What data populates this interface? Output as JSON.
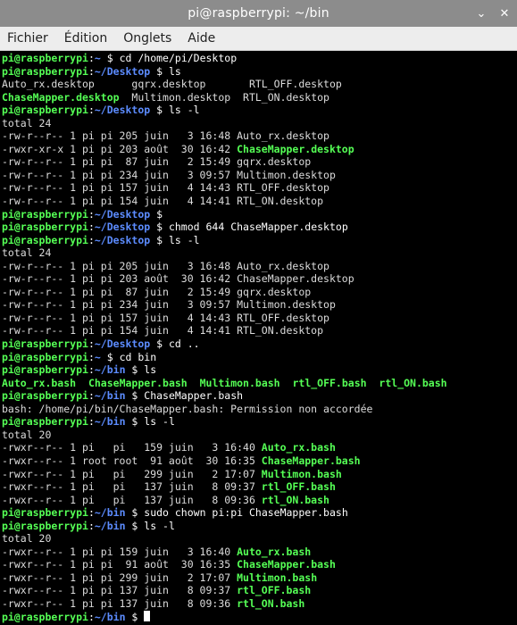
{
  "window": {
    "title": "pi@raspberrypi: ~/bin",
    "min_icon": "chevron-down-icon",
    "close_icon": "close-icon"
  },
  "menu": [
    "Fichier",
    "Édition",
    "Onglets",
    "Aide"
  ],
  "colors": {
    "prompt": "#55ff55",
    "path": "#5c8cff",
    "exec": "#55ff55",
    "titlebar": "#8c8c8c",
    "menubar": "#ededed"
  },
  "terminal": [
    [
      [
        "p",
        "pi@raspberrypi"
      ],
      [
        "c",
        ":"
      ],
      [
        "d",
        "~"
      ],
      [
        "c",
        " $ cd /home/pi/Desktop"
      ]
    ],
    [
      [
        "p",
        "pi@raspberrypi"
      ],
      [
        "c",
        ":"
      ],
      [
        "d",
        "~/Desktop"
      ],
      [
        "c",
        " $ ls"
      ]
    ],
    [
      [
        "o",
        "Auto_rx.desktop      gqrx.desktop       RTL_OFF.desktop"
      ]
    ],
    [
      [
        "g",
        "ChaseMapper.desktop"
      ],
      [
        "o",
        "  Multimon.desktop  RTL_ON.desktop"
      ]
    ],
    [
      [
        "p",
        "pi@raspberrypi"
      ],
      [
        "c",
        ":"
      ],
      [
        "d",
        "~/Desktop"
      ],
      [
        "c",
        " $ ls -l"
      ]
    ],
    [
      [
        "o",
        "total 24"
      ]
    ],
    [
      [
        "o",
        "-rw-r--r-- 1 pi pi 205 juin   3 16:48 Auto_rx.desktop"
      ]
    ],
    [
      [
        "o",
        "-rwxr-xr-x 1 pi pi 203 août  30 16:42 "
      ],
      [
        "g",
        "ChaseMapper.desktop"
      ]
    ],
    [
      [
        "o",
        "-rw-r--r-- 1 pi pi  87 juin   2 15:49 gqrx.desktop"
      ]
    ],
    [
      [
        "o",
        "-rw-r--r-- 1 pi pi 234 juin   3 09:57 Multimon.desktop"
      ]
    ],
    [
      [
        "o",
        "-rw-r--r-- 1 pi pi 157 juin   4 14:43 RTL_OFF.desktop"
      ]
    ],
    [
      [
        "o",
        "-rw-r--r-- 1 pi pi 154 juin   4 14:41 RTL_ON.desktop"
      ]
    ],
    [
      [
        "p",
        "pi@raspberrypi"
      ],
      [
        "c",
        ":"
      ],
      [
        "d",
        "~/Desktop"
      ],
      [
        "c",
        " $"
      ]
    ],
    [
      [
        "p",
        "pi@raspberrypi"
      ],
      [
        "c",
        ":"
      ],
      [
        "d",
        "~/Desktop"
      ],
      [
        "c",
        " $ chmod 644 ChaseMapper.desktop"
      ]
    ],
    [
      [
        "p",
        "pi@raspberrypi"
      ],
      [
        "c",
        ":"
      ],
      [
        "d",
        "~/Desktop"
      ],
      [
        "c",
        " $ ls -l"
      ]
    ],
    [
      [
        "o",
        "total 24"
      ]
    ],
    [
      [
        "o",
        "-rw-r--r-- 1 pi pi 205 juin   3 16:48 Auto_rx.desktop"
      ]
    ],
    [
      [
        "o",
        "-rw-r--r-- 1 pi pi 203 août  30 16:42 ChaseMapper.desktop"
      ]
    ],
    [
      [
        "o",
        "-rw-r--r-- 1 pi pi  87 juin   2 15:49 gqrx.desktop"
      ]
    ],
    [
      [
        "o",
        "-rw-r--r-- 1 pi pi 234 juin   3 09:57 Multimon.desktop"
      ]
    ],
    [
      [
        "o",
        "-rw-r--r-- 1 pi pi 157 juin   4 14:43 RTL_OFF.desktop"
      ]
    ],
    [
      [
        "o",
        "-rw-r--r-- 1 pi pi 154 juin   4 14:41 RTL_ON.desktop"
      ]
    ],
    [
      [
        "p",
        "pi@raspberrypi"
      ],
      [
        "c",
        ":"
      ],
      [
        "d",
        "~/Desktop"
      ],
      [
        "c",
        " $ cd .."
      ]
    ],
    [
      [
        "p",
        "pi@raspberrypi"
      ],
      [
        "c",
        ":"
      ],
      [
        "d",
        "~"
      ],
      [
        "c",
        " $ cd bin"
      ]
    ],
    [
      [
        "p",
        "pi@raspberrypi"
      ],
      [
        "c",
        ":"
      ],
      [
        "d",
        "~/bin"
      ],
      [
        "c",
        " $ ls"
      ]
    ],
    [
      [
        "g",
        "Auto_rx.bash"
      ],
      [
        "o",
        "  "
      ],
      [
        "g",
        "ChaseMapper.bash"
      ],
      [
        "o",
        "  "
      ],
      [
        "g",
        "Multimon.bash"
      ],
      [
        "o",
        "  "
      ],
      [
        "g",
        "rtl_OFF.bash"
      ],
      [
        "o",
        "  "
      ],
      [
        "g",
        "rtl_ON.bash"
      ]
    ],
    [
      [
        "p",
        "pi@raspberrypi"
      ],
      [
        "c",
        ":"
      ],
      [
        "d",
        "~/bin"
      ],
      [
        "c",
        " $ ChaseMapper.bash"
      ]
    ],
    [
      [
        "o",
        "bash: /home/pi/bin/ChaseMapper.bash: Permission non accordée"
      ]
    ],
    [
      [
        "p",
        "pi@raspberrypi"
      ],
      [
        "c",
        ":"
      ],
      [
        "d",
        "~/bin"
      ],
      [
        "c",
        " $ ls -l"
      ]
    ],
    [
      [
        "o",
        "total 20"
      ]
    ],
    [
      [
        "o",
        "-rwxr--r-- 1 pi   pi   159 juin   3 16:40 "
      ],
      [
        "g",
        "Auto_rx.bash"
      ]
    ],
    [
      [
        "o",
        "-rwxr--r-- 1 root root  91 août  30 16:35 "
      ],
      [
        "g",
        "ChaseMapper.bash"
      ]
    ],
    [
      [
        "o",
        "-rwxr--r-- 1 pi   pi   299 juin   2 17:07 "
      ],
      [
        "g",
        "Multimon.bash"
      ]
    ],
    [
      [
        "o",
        "-rwxr--r-- 1 pi   pi   137 juin   8 09:37 "
      ],
      [
        "g",
        "rtl_OFF.bash"
      ]
    ],
    [
      [
        "o",
        "-rwxr--r-- 1 pi   pi   137 juin   8 09:36 "
      ],
      [
        "g",
        "rtl_ON.bash"
      ]
    ],
    [
      [
        "p",
        "pi@raspberrypi"
      ],
      [
        "c",
        ":"
      ],
      [
        "d",
        "~/bin"
      ],
      [
        "c",
        " $ sudo chown pi:pi ChaseMapper.bash"
      ]
    ],
    [
      [
        "p",
        "pi@raspberrypi"
      ],
      [
        "c",
        ":"
      ],
      [
        "d",
        "~/bin"
      ],
      [
        "c",
        " $ ls -l"
      ]
    ],
    [
      [
        "o",
        "total 20"
      ]
    ],
    [
      [
        "o",
        "-rwxr--r-- 1 pi pi 159 juin   3 16:40 "
      ],
      [
        "g",
        "Auto_rx.bash"
      ]
    ],
    [
      [
        "o",
        "-rwxr--r-- 1 pi pi  91 août  30 16:35 "
      ],
      [
        "g",
        "ChaseMapper.bash"
      ]
    ],
    [
      [
        "o",
        "-rwxr--r-- 1 pi pi 299 juin   2 17:07 "
      ],
      [
        "g",
        "Multimon.bash"
      ]
    ],
    [
      [
        "o",
        "-rwxr--r-- 1 pi pi 137 juin   8 09:37 "
      ],
      [
        "g",
        "rtl_OFF.bash"
      ]
    ],
    [
      [
        "o",
        "-rwxr--r-- 1 pi pi 137 juin   8 09:36 "
      ],
      [
        "g",
        "rtl_ON.bash"
      ]
    ],
    [
      [
        "p",
        "pi@raspberrypi"
      ],
      [
        "c",
        ":"
      ],
      [
        "d",
        "~/bin"
      ],
      [
        "c",
        " $ "
      ]
    ]
  ]
}
